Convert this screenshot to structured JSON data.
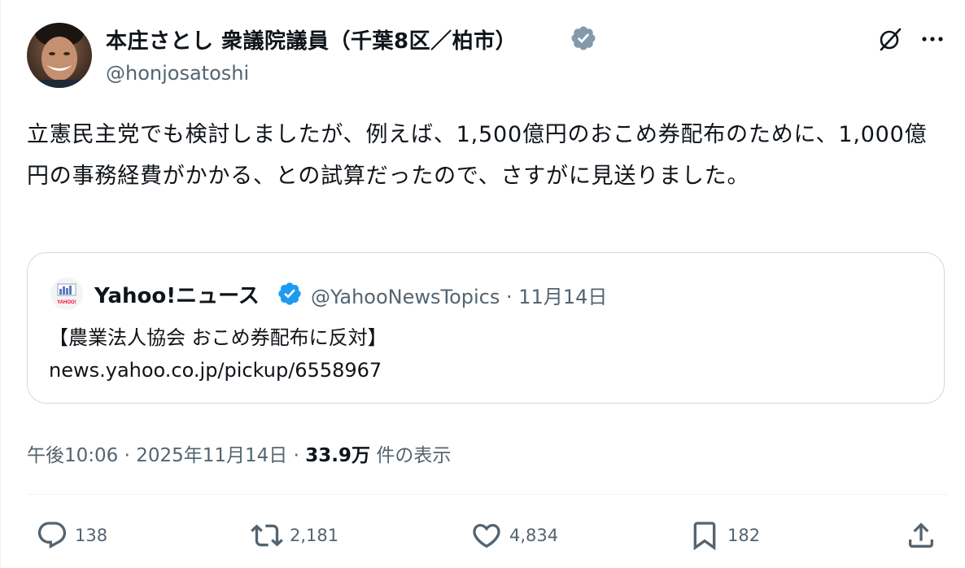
{
  "author": {
    "name": "本庄さとし 衆議院議員（千葉8区／柏市）",
    "handle": "@honjosatoshi"
  },
  "tweet": {
    "text": "立憲民主党でも検討しましたが、例えば、1,500億円のおこめ券配布のために、1,000億円の事務経費がかかる、との試算だったので、さすがに見送りました。"
  },
  "quote": {
    "name": "Yahoo!ニュース",
    "handle": "@YahooNewsTopics",
    "separator": "·",
    "date": "11月14日",
    "text": "【農業法人協会 おこめ券配布に反対】\nnews.yahoo.co.jp/pickup/6558967",
    "avatar_mark": "YAHOO!"
  },
  "meta": {
    "time": "午後10:06",
    "separator": "·",
    "date": "2025年11月14日",
    "views_count": "33.9万",
    "views_label": "件の表示"
  },
  "actions": {
    "replies": "138",
    "retweets": "2,181",
    "likes": "4,834",
    "bookmarks": "182"
  },
  "colors": {
    "text": "#0f1419",
    "secondary": "#536471",
    "border": "#cfd9de",
    "verified_blue": "#1d9bf0",
    "verified_grey": "#829aab"
  },
  "icons": [
    "grok-icon",
    "more-icon",
    "verified-badge-icon",
    "reply-icon",
    "retweet-icon",
    "like-icon",
    "bookmark-icon",
    "share-icon"
  ]
}
